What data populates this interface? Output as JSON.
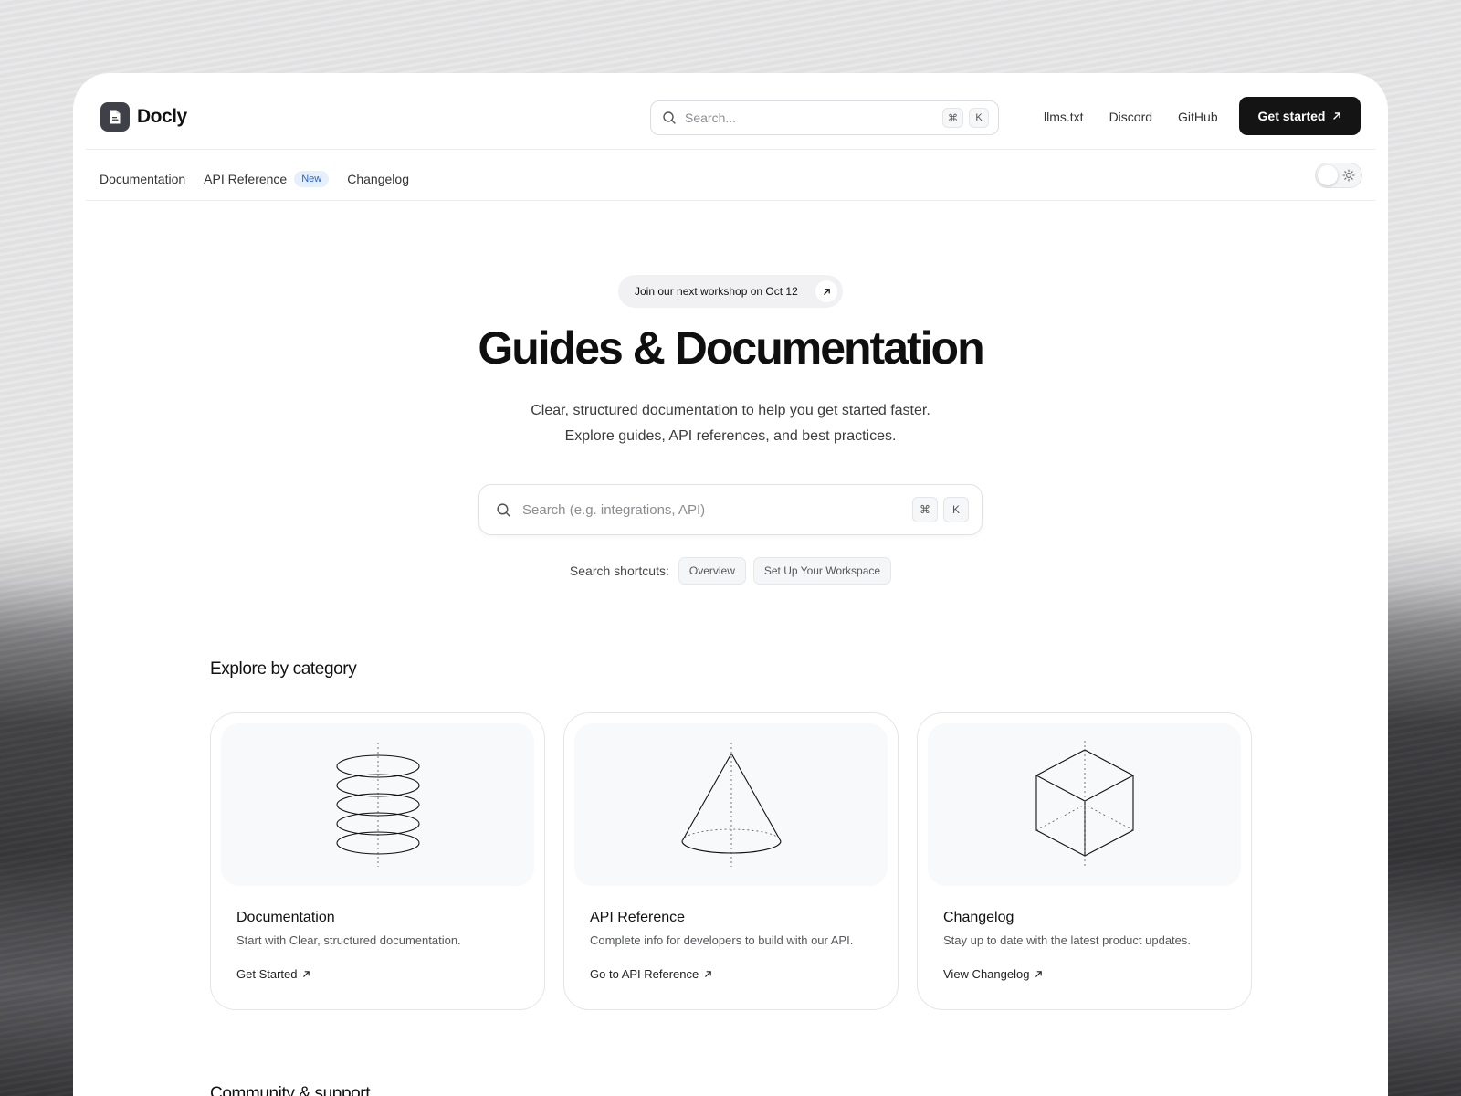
{
  "brand": {
    "name": "Docly"
  },
  "header": {
    "search_placeholder": "Search...",
    "search_kbd_1": "⌘",
    "search_kbd_2": "K",
    "links": [
      "llms.txt",
      "Discord",
      "GitHub"
    ],
    "cta_label": "Get started"
  },
  "subnav": {
    "items": [
      "Documentation",
      "API Reference",
      "Changelog"
    ],
    "new_badge": "New"
  },
  "hero": {
    "announcement": "Join our next workshop on Oct 12",
    "title": "Guides & Documentation",
    "subtitle_line1": "Clear, structured documentation to help you get started faster.",
    "subtitle_line2": "Explore guides, API references, and best practices.",
    "search_placeholder": "Search (e.g. integrations, API)",
    "search_kbd_1": "⌘",
    "search_kbd_2": "K",
    "shortcuts_label": "Search shortcuts:",
    "shortcuts": [
      "Overview",
      "Set Up Your Workspace"
    ]
  },
  "categories": {
    "title": "Explore by category",
    "cards": [
      {
        "title": "Documentation",
        "description": "Start with Clear, structured documentation.",
        "link": "Get Started",
        "art_icon": "stacked-discs-icon"
      },
      {
        "title": "API Reference",
        "description": "Complete info for developers to build with our API.",
        "link": "Go to API Reference",
        "art_icon": "cone-icon"
      },
      {
        "title": "Changelog",
        "description": "Stay up to date with the latest product updates.",
        "link": "View Changelog",
        "art_icon": "cube-icon"
      }
    ]
  },
  "community": {
    "title": "Community & support"
  },
  "colors": {
    "cta_bg": "#141414",
    "badge_bg": "#e6effc",
    "badge_text": "#2563c7"
  }
}
